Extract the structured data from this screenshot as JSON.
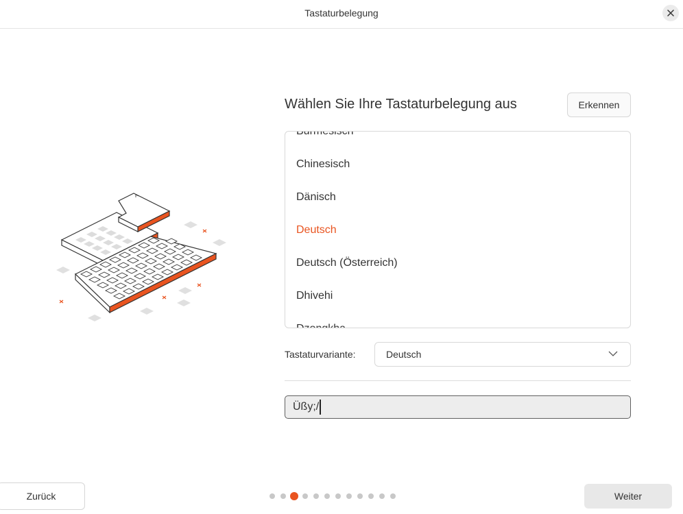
{
  "window": {
    "title": "Tastaturbelegung"
  },
  "heading": "Wählen Sie Ihre Tastaturbelegung aus",
  "detect_button": "Erkennen",
  "languages": {
    "items": [
      "Burmesisch",
      "Chinesisch",
      "Dänisch",
      "Deutsch",
      "Deutsch (Österreich)",
      "Dhivehi",
      "Dzongkha"
    ],
    "selected": "Deutsch"
  },
  "variant": {
    "label": "Tastaturvariante:",
    "value": "Deutsch"
  },
  "test_input": {
    "value": "Üßy;/"
  },
  "nav": {
    "back": "Zurück",
    "next": "Weiter"
  },
  "progress": {
    "current_step": 3,
    "total_steps": 12
  },
  "colors": {
    "accent": "#e95420",
    "text": "#333333",
    "border": "#d8d8d8"
  },
  "icons": {
    "close": "close-icon",
    "dropdown": "chevron-down-icon"
  }
}
